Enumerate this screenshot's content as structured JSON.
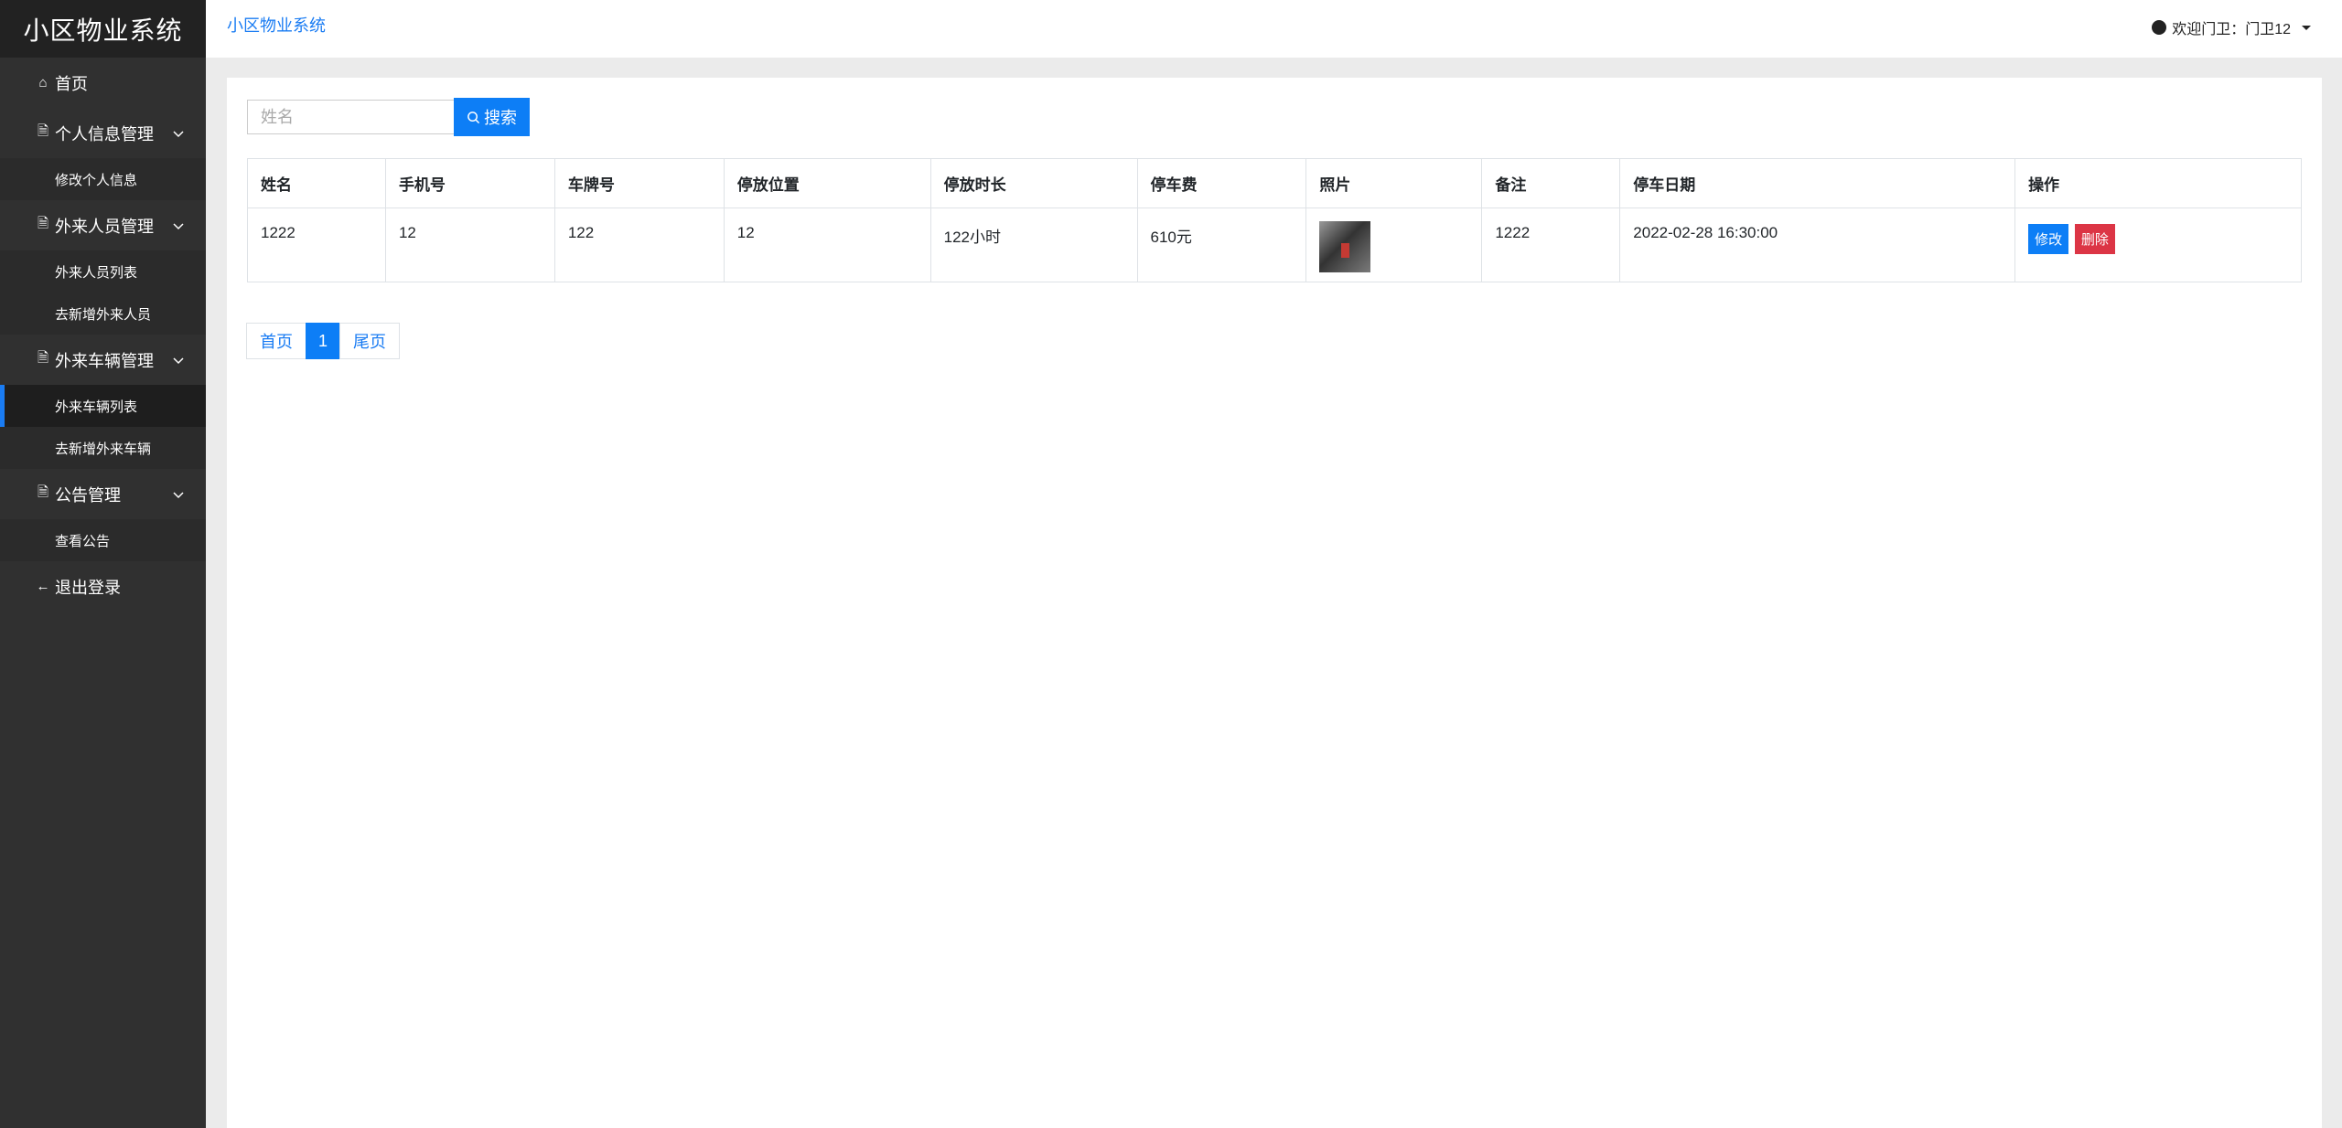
{
  "app": {
    "brand": "小区物业系统",
    "breadcrumb": "小区物业系统"
  },
  "user": {
    "welcome": "欢迎门卫：门卫12"
  },
  "sidebar": {
    "home": "首页",
    "groups": [
      {
        "label": "个人信息管理",
        "items": [
          "修改个人信息"
        ]
      },
      {
        "label": "外来人员管理",
        "items": [
          "外来人员列表",
          "去新增外来人员"
        ]
      },
      {
        "label": "外来车辆管理",
        "items": [
          "外来车辆列表",
          "去新增外来车辆"
        ]
      },
      {
        "label": "公告管理",
        "items": [
          "查看公告"
        ]
      }
    ],
    "logout": "退出登录",
    "active_item": "外来车辆列表"
  },
  "search": {
    "placeholder": "姓名",
    "button": "搜索"
  },
  "table": {
    "headers": [
      "姓名",
      "手机号",
      "车牌号",
      "停放位置",
      "停放时长",
      "停车费",
      "照片",
      "备注",
      "停车日期",
      "操作"
    ],
    "rows": [
      {
        "name": "1222",
        "phone": "12",
        "plate": "122",
        "location": "12",
        "duration": "122小时",
        "fee": "610元",
        "note": "1222",
        "date": "2022-02-28 16:30:00",
        "edit": "修改",
        "delete": "删除"
      }
    ]
  },
  "pagination": {
    "first": "首页",
    "current": "1",
    "last": "尾页"
  },
  "colors": {
    "accent": "#0d7ef6",
    "danger": "#dc3545",
    "sidebar": "#303030",
    "active_marker": "#1a7cf3"
  }
}
